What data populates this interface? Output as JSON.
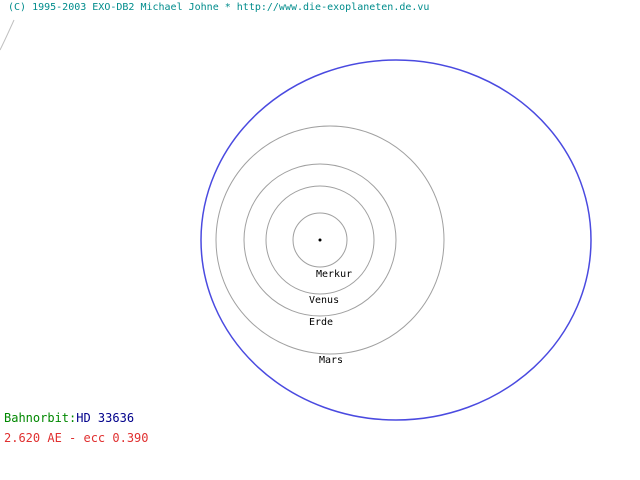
{
  "credit": "(C) 1995-2003 EXO-DB2 Michael Johne * http://www.die-exoplaneten.de.vu",
  "orbit_info": {
    "label": "Bahnorbit:",
    "star_name": "HD 33636",
    "elements": "2.620 AE - ecc 0.390"
  },
  "planets": [
    {
      "name": "Merkur"
    },
    {
      "name": "Venus"
    },
    {
      "name": "Erde"
    },
    {
      "name": "Mars"
    }
  ],
  "colors": {
    "credit": "#008c8c",
    "label": "#008800",
    "star_name": "#00008b",
    "elements": "#e03030",
    "orbit": "#4a4ae0",
    "planet_orbit": "#a0a0a0",
    "text": "#000000"
  }
}
